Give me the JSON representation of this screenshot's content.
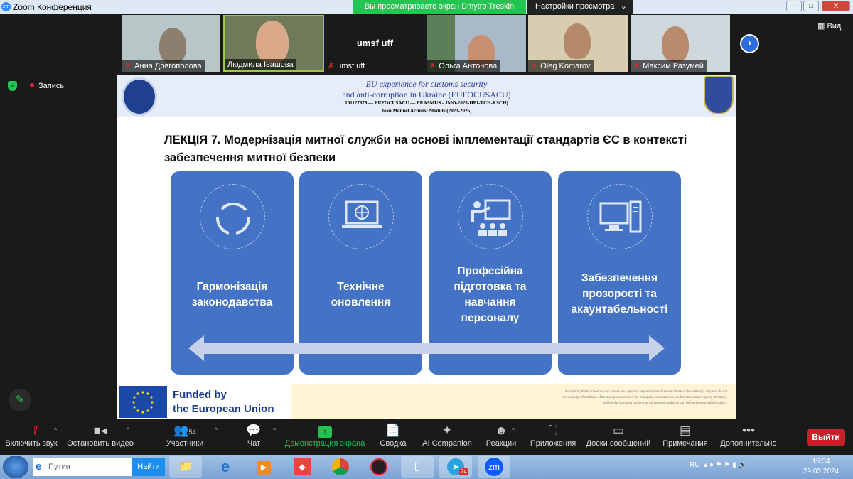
{
  "window": {
    "title": "Zoom Конференция",
    "logo": "zm",
    "min": "–",
    "max": "□",
    "close": "X"
  },
  "share_banner": "Вы просматриваете экран Dmytro Treskin",
  "view_settings": "Настройки просмотра",
  "view_settings_chevron": "⌄",
  "participants": [
    {
      "name": "Анна Довгополова",
      "muted": true
    },
    {
      "name": "Людмила Івашова",
      "muted": false
    },
    {
      "name": "umsf uff",
      "muted": true,
      "placeholder": "umsf uff"
    },
    {
      "name": "Ольга Антонова",
      "muted": true
    },
    {
      "name": "Oleg Komarov",
      "muted": true
    },
    {
      "name": "Максим Разумей",
      "muted": true
    }
  ],
  "next_page": "›",
  "view_button": "Вид",
  "recording": "Запись",
  "slide": {
    "header": {
      "line1": "EU experience for customs security",
      "line2": "and anti-corruption  in Ukraine (EUFOCUSACU)",
      "line3": "101127879 — EUFOCUSACU  — ERASMUS - JMO-2023-HEI-TCH-RSCH)",
      "line4": "Jean Monnet Actions: Module (2023-2026)"
    },
    "title": "ЛЕКЦІЯ 7. Модернізація митної служби на основі імплементації стандартів ЄС в контексті забезпечення  митної безпеки",
    "cards": [
      {
        "icon": "refresh-cycle-icon",
        "line1": "Гармонізація",
        "line2": "законодавства"
      },
      {
        "icon": "laptop-globe-icon",
        "line1": "Технічне",
        "line2": "оновлення"
      },
      {
        "icon": "teacher-presentation-icon",
        "line1": "Професійна",
        "line2": "підготовка та",
        "line3": "навчання",
        "line4": "персоналу"
      },
      {
        "icon": "desktop-computer-icon",
        "line1": "Забезпечення",
        "line2": "прозорості та",
        "line3": "акаунтабельності"
      }
    ],
    "funded_line1": "Funded by",
    "funded_line2": "the European Union",
    "disclaimer": "Funded by the European Union. Views and opinions expressed are however those of the author(s) only and do not necessarily reflect those of the European Union or the European Education and Culture Executive Agency (EACEA). Neither the European Union nor the granting authority can be held responsible for them."
  },
  "toolbar": {
    "unmute": "Включить звук",
    "stop_video": "Остановить видео",
    "participants": "Участники",
    "participants_count": "54",
    "chat": "Чат",
    "share": "Демонстрация экрана",
    "summary": "Сводка",
    "ai": "AI Companion",
    "reactions": "Реакции",
    "apps": "Приложения",
    "whiteboards": "Доски сообщений",
    "notes": "Примечания",
    "more": "Дополнительно",
    "leave": "Выйти"
  },
  "taskbar": {
    "search_value": "Путин",
    "find": "Найти",
    "telegram_badge": "24",
    "zoom": "zm",
    "lang": "RU",
    "time": "15:34",
    "date": "29.03.2024"
  },
  "colors": {
    "card": "#4472c4",
    "share_green": "#23c552",
    "leave_red": "#c4222a"
  }
}
